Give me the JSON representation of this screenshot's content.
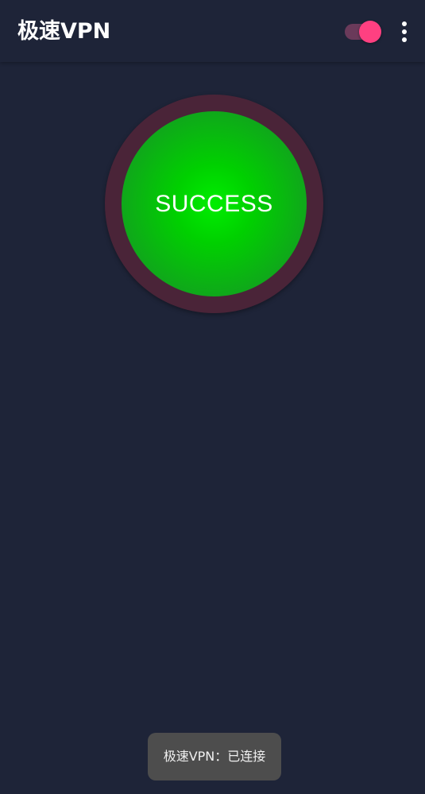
{
  "app_bar": {
    "title": "极速VPN",
    "toggle": {
      "state": "on",
      "track_color": "#6a3a5a",
      "thumb_color": "#ff4081"
    },
    "overflow_icon": "more-vertical-icon"
  },
  "main": {
    "connect_button": {
      "label": "SUCCESS",
      "state": "connected",
      "ring_color": "#4a2438",
      "fill_color": "#00e000"
    }
  },
  "toast": {
    "message": "极速VPN：已连接"
  },
  "colors": {
    "background": "#1e2438",
    "accent": "#ff4081",
    "success": "#00e000"
  }
}
